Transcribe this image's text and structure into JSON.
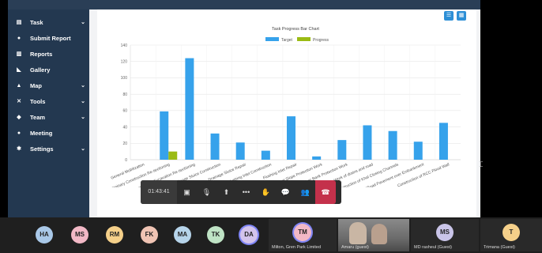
{
  "sidebar": {
    "items": [
      {
        "label": "Task",
        "icon": "task-icon",
        "has_chevron": true
      },
      {
        "label": "Submit Report",
        "icon": "report-icon",
        "has_chevron": false
      },
      {
        "label": "Reports",
        "icon": "chart-icon",
        "has_chevron": false
      },
      {
        "label": "Gallery",
        "icon": "gallery-icon",
        "has_chevron": false
      },
      {
        "label": "Map",
        "icon": "map-icon",
        "has_chevron": true
      },
      {
        "label": "Tools",
        "icon": "tools-icon",
        "has_chevron": true
      },
      {
        "label": "Team",
        "icon": "team-icon",
        "has_chevron": true
      },
      {
        "label": "Meeting",
        "icon": "meeting-icon",
        "has_chevron": false
      },
      {
        "label": "Settings",
        "icon": "settings-icon",
        "has_chevron": true
      }
    ]
  },
  "chart_data": {
    "type": "bar",
    "title": "Task Progress Bar Chart",
    "legend_position": "top",
    "categories": [
      "General Mobilization",
      "Preliminary Construction Re-sectioning",
      "Drainage Sluice Excavation Re-sectioning",
      "Drainage Sluice Construction",
      "Drainage Sluice Repair",
      "Flushing Inlet Construction",
      "Flushing Inlet Repair",
      "Embankment Slope Protection Work",
      "River Bank Protection Work",
      "Re-sectioning Work of drains and road",
      "Construction of Khal Closing Channels",
      "Construction of Road Pavement over Embankment",
      "Construction of RCC Flood Wall"
    ],
    "series": [
      {
        "name": "Target",
        "color": "#36a2eb",
        "values": [
          0,
          59,
          124,
          32,
          21,
          11,
          53,
          4,
          24,
          42,
          35,
          22,
          45
        ]
      },
      {
        "name": "Progress",
        "color": "#9bbb14",
        "values": [
          0,
          10,
          0,
          0,
          0,
          0,
          0,
          0,
          0,
          0,
          0,
          0,
          0
        ]
      }
    ],
    "ylim": [
      0,
      140
    ],
    "yticks": [
      0,
      20,
      40,
      60,
      80,
      100,
      120,
      140
    ],
    "grid": true
  },
  "meeting": {
    "timer": "01:43:41",
    "controls": [
      {
        "name": "camera-off-icon",
        "glyph": "▣"
      },
      {
        "name": "mic-off-icon",
        "glyph": "🎙"
      },
      {
        "name": "share-screen-icon",
        "glyph": "⬆"
      },
      {
        "name": "more-icon",
        "glyph": "•••"
      },
      {
        "name": "raise-hand-icon",
        "glyph": "✋"
      },
      {
        "name": "chat-icon",
        "glyph": "💬"
      },
      {
        "name": "people-icon",
        "glyph": "👥"
      }
    ],
    "end_call": "end-call-icon"
  },
  "participants": [
    {
      "initials": "HA",
      "color": "#a9c8e8",
      "name": ""
    },
    {
      "initials": "MS",
      "color": "#f2b8c6",
      "name": ""
    },
    {
      "initials": "RM",
      "color": "#f5d08a",
      "name": ""
    },
    {
      "initials": "FK",
      "color": "#f0c4b4",
      "name": ""
    },
    {
      "initials": "MA",
      "color": "#b6d4ea",
      "name": ""
    },
    {
      "initials": "TK",
      "color": "#bfe3c5",
      "name": ""
    },
    {
      "initials": "DA",
      "color": "#d4c4ec",
      "name": ""
    },
    {
      "initials": "TM",
      "color": "#f2b8c6",
      "name": "Milton, Gren Park Limited"
    },
    {
      "initials": "",
      "color": "#5a5a5a",
      "name": "Amaru (guest)"
    },
    {
      "initials": "MS",
      "color": "#c9c4e8",
      "name": "MD rasheul (Guest)"
    },
    {
      "initials": "T",
      "color": "#f5d08a",
      "name": "Trimana (Guest)"
    }
  ]
}
